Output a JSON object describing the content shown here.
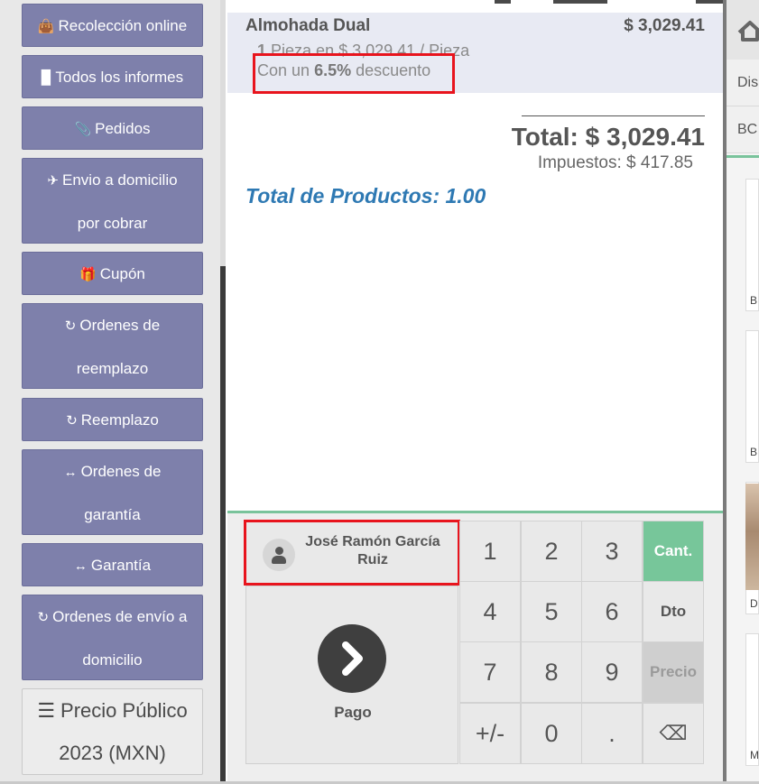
{
  "sidebar": {
    "buttons": [
      {
        "icon": "shopping-bag-icon",
        "glyph": "👜",
        "label": "Recolección online"
      },
      {
        "icon": "file-icon",
        "glyph": "▉",
        "label": "Todos los informes"
      },
      {
        "icon": "paperclip-icon",
        "glyph": "📎",
        "label": "Pedidos"
      },
      {
        "icon": "paper-plane-icon",
        "glyph": "✈",
        "label": "Envio a domicilio",
        "label2": "por cobrar"
      },
      {
        "icon": "gift-icon",
        "glyph": "🎁",
        "label": "Cupón"
      },
      {
        "icon": "refresh-icon",
        "glyph": "↻",
        "label": "Ordenes de",
        "label2": "reemplazo"
      },
      {
        "icon": "refresh-icon",
        "glyph": "↻",
        "label": "Reemplazo"
      },
      {
        "icon": "arrows-h-icon",
        "glyph": "↔",
        "label": "Ordenes de",
        "label2": "garantía"
      },
      {
        "icon": "arrows-h-icon",
        "glyph": "↔",
        "label": "Garantía"
      },
      {
        "icon": "refresh-icon",
        "glyph": "↻",
        "label": "Ordenes de envío a",
        "label2": "domicilio"
      }
    ],
    "pricelist": {
      "icon": "list-icon",
      "glyph": "☰",
      "line1": "Precio Público",
      "line2": "2023 (MXN)"
    }
  },
  "order": {
    "line": {
      "product": "Almohada Dual",
      "price": "$ 3,029.41",
      "qty": "1",
      "qty_text": "Pieza en $ 3,029.41 / Pieza",
      "discount_prefix": "Con un",
      "discount_value": "6.5%",
      "discount_suffix": "descuento"
    },
    "total": "Total: $ 3,029.41",
    "taxes": "Impuestos: $ 417.85",
    "total_products": "Total de Productos: 1.00"
  },
  "customer": {
    "name": "José Ramón García Ruiz"
  },
  "payment": {
    "label": "Pago"
  },
  "numpad": {
    "keys": [
      "1",
      "2",
      "3",
      "Cant.",
      "4",
      "5",
      "6",
      "Dto",
      "7",
      "8",
      "9",
      "Precio",
      "+/-",
      "0",
      ".",
      "⌫"
    ]
  },
  "right_panel": {
    "rows": [
      "Dis",
      "BC"
    ],
    "cards": [
      "B",
      "B",
      "D",
      "M"
    ]
  },
  "colors": {
    "sidebar_button": "#7e80ab",
    "accent_green": "#77c69a",
    "highlight_red": "#e8141d",
    "total_products_blue": "#2e79b3"
  }
}
